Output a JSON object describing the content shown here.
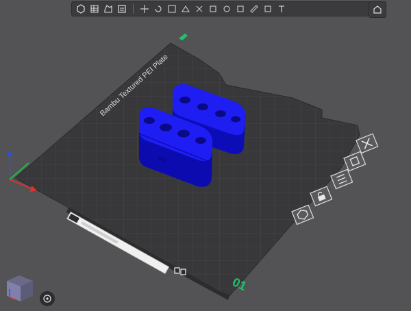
{
  "toolbar": {
    "buttons": [
      {
        "icon": "add-object-icon"
      },
      {
        "icon": "arrange-icon"
      },
      {
        "icon": "orient-icon"
      },
      {
        "icon": "plate-icon"
      },
      {
        "icon": "move-icon"
      },
      {
        "icon": "rotate-icon"
      },
      {
        "icon": "scale-icon"
      },
      {
        "icon": "lay-on-face-icon"
      },
      {
        "icon": "cut-icon"
      },
      {
        "icon": "support-paint-icon"
      },
      {
        "icon": "seam-paint-icon"
      },
      {
        "icon": "color-paint-icon"
      },
      {
        "icon": "measure-icon"
      },
      {
        "icon": "assembly-icon"
      },
      {
        "icon": "text-icon"
      }
    ]
  },
  "plate": {
    "label": "Bambu Textured PEI Plate",
    "number": "01",
    "plate_name_placeholder": "",
    "accent": "#1fc46a"
  },
  "plate_actions": [
    {
      "icon": "delete-plate-icon"
    },
    {
      "icon": "arrange-plate-icon"
    },
    {
      "icon": "plate-settings-icon"
    },
    {
      "icon": "lock-plate-icon"
    },
    {
      "icon": "orient-plate-icon"
    }
  ],
  "colors": {
    "background": "#535356",
    "plate": "#3a3a3c",
    "grid": "#4a4a4d",
    "model": "#1a1aee",
    "model_dark": "#0a0a9a"
  }
}
